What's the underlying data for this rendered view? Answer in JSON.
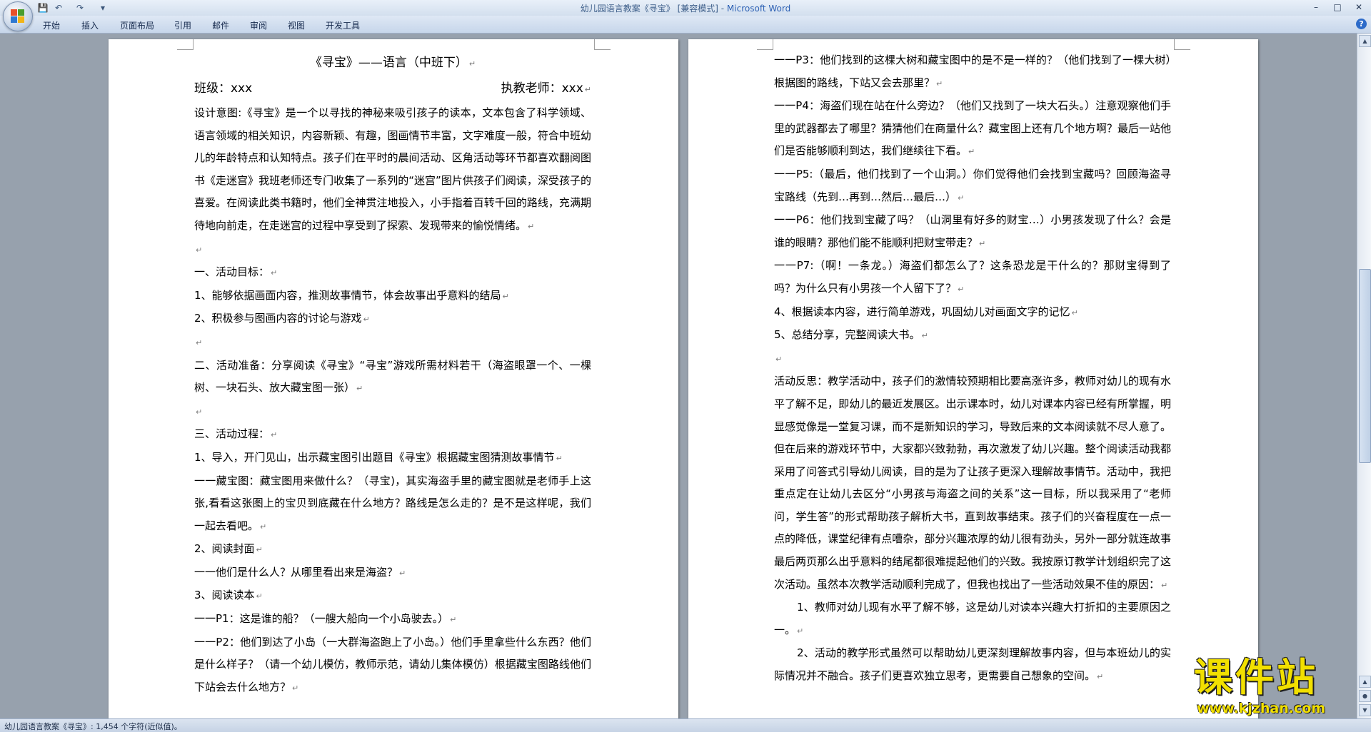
{
  "window": {
    "title": "幼儿园语言教案《寻宝》 [兼容模式] - ",
    "app_name": "Microsoft Word",
    "minimize": "–",
    "maximize": "□",
    "close": "✕"
  },
  "quick_access": {
    "save_icon": "💾",
    "undo_icon": "↶",
    "redo_icon": "↷",
    "customize_icon": "▾"
  },
  "ribbon": {
    "tabs": [
      "开始",
      "插入",
      "页面布局",
      "引用",
      "邮件",
      "审阅",
      "视图",
      "开发工具"
    ],
    "help": "?"
  },
  "pilcrow": "↵",
  "left_page": {
    "title": "《寻宝》——语言（中班下）",
    "class_label": "班级：xxx",
    "teacher_label": "执教老师：xxx",
    "paragraphs": [
      "设计意图:《寻宝》是一个以寻找的神秘来吸引孩子的读本，文本包含了科学领域、语言领域的相关知识，内容新颖、有趣，图画情节丰富，文字难度一般，符合中班幼儿的年龄特点和认知特点。孩子们在平时的晨间活动、区角活动等环节都喜欢翻阅图书《走迷宫》我班老师还专门收集了一系列的“迷宫”图片供孩子们阅读，深受孩子的喜爱。在阅读此类书籍时，他们全神贯注地投入，小手指着百转千回的路线，充满期待地向前走，在走迷宫的过程中享受到了探索、发现带来的愉悦情绪。",
      "",
      "一、活动目标：",
      "1、能够依据画面内容，推测故事情节，体会故事出乎意料的结局",
      "2、积极参与图画内容的讨论与游戏",
      "",
      "二、活动准备：分享阅读《寻宝》“寻宝”游戏所需材料若干（海盗眼罩一个、一棵树、一块石头、放大藏宝图一张）",
      "",
      "三、活动过程：",
      "1、导入，开门见山，出示藏宝图引出题目《寻宝》根据藏宝图猜测故事情节",
      "一一藏宝图：藏宝图用来做什么？（寻宝)，其实海盗手里的藏宝图就是老师手上这张,看看这张图上的宝贝到底藏在什么地方？路线是怎么走的？是不是这样呢，我们一起去看吧。",
      "2、阅读封面",
      "一一他们是什么人？从哪里看出来是海盗？",
      "3、阅读读本",
      "一一P1：这是谁的船？（一艘大船向一个小岛驶去。）",
      "一一P2：他们到达了小岛（一大群海盗跑上了小岛。）他们手里拿些什么东西？他们是什么样子？（请一个幼儿模仿，教师示范，请幼儿集体模仿）根据藏宝图路线他们下站会去什么地方？"
    ]
  },
  "right_page": {
    "paragraphs": [
      "一一P3：他们找到的这棵大树和藏宝图中的是不是一样的？（他们找到了一棵大树）根据图的路线，下站又会去那里？",
      "一一P4：海盗们现在站在什么旁边？（他们又找到了一块大石头。）注意观察他们手里的武器都去了哪里？猜猜他们在商量什么？藏宝图上还有几个地方啊？最后一站他们是否能够顺利到达，我们继续往下看。",
      "一一P5:（最后，他们找到了一个山洞。）你们觉得他们会找到宝藏吗？回顾海盗寻宝路线（先到…再到…然后…最后…）",
      "一一P6：他们找到宝藏了吗？（山洞里有好多的财宝…）小男孩发现了什么？会是谁的眼睛？那他们能不能顺利把财宝带走？",
      "一一P7:（啊！一条龙。）海盗们都怎么了？这条恐龙是干什么的？那财宝得到了吗？为什么只有小男孩一个人留下了？",
      "4、根据读本内容，进行简单游戏，巩固幼儿对画面文字的记忆",
      "5、总结分享，完整阅读大书。",
      "",
      "活动反思：教学活动中，孩子们的激情较预期相比要高涨许多，教师对幼儿的现有水平了解不足，即幼儿的最近发展区。出示课本时，幼儿对课本内容已经有所掌握，明显感觉像是一堂复习课，而不是新知识的学习，导致后来的文本阅读就不尽人意了。但在后来的游戏环节中，大家都兴致勃勃，再次激发了幼儿兴趣。整个阅读活动我都采用了问答式引导幼儿阅读，目的是为了让孩子更深入理解故事情节。活动中，我把重点定在让幼儿去区分“小男孩与海盗之间的关系”这一目标，所以我采用了“老师问，学生答”的形式帮助孩子解析大书，直到故事结束。孩子们的兴奋程度在一点一点的降低，课堂纪律有点嘈杂，部分兴趣浓厚的幼儿很有劲头，另外一部分就连故事最后两页那么出乎意料的结尾都很难提起他们的兴致。我按原订教学计划组织完了这次活动。虽然本次教学活动顺利完成了，但我也找出了一些活动效果不佳的原因：",
      "1、教师对幼儿现有水平了解不够，这是幼儿对读本兴趣大打折扣的主要原因之一。",
      "2、活动的教学形式虽然可以帮助幼儿更深刻理解故事内容，但与本班幼儿的实际情况并不融合。孩子们更喜欢独立思考，更需要自己想象的空间。"
    ],
    "indented": [
      9,
      10
    ]
  },
  "status_bar": {
    "text": "幼儿园语言教案《寻宝》: 1,454 个字符(近似值)。"
  },
  "watermark": {
    "brand": "课件站",
    "url": "www.kjzhan.com"
  },
  "colors": {
    "page": "#ffffff",
    "workspace": "#97a1ad",
    "watermark": "#f2e000",
    "title_blue": "#2e62b5"
  }
}
